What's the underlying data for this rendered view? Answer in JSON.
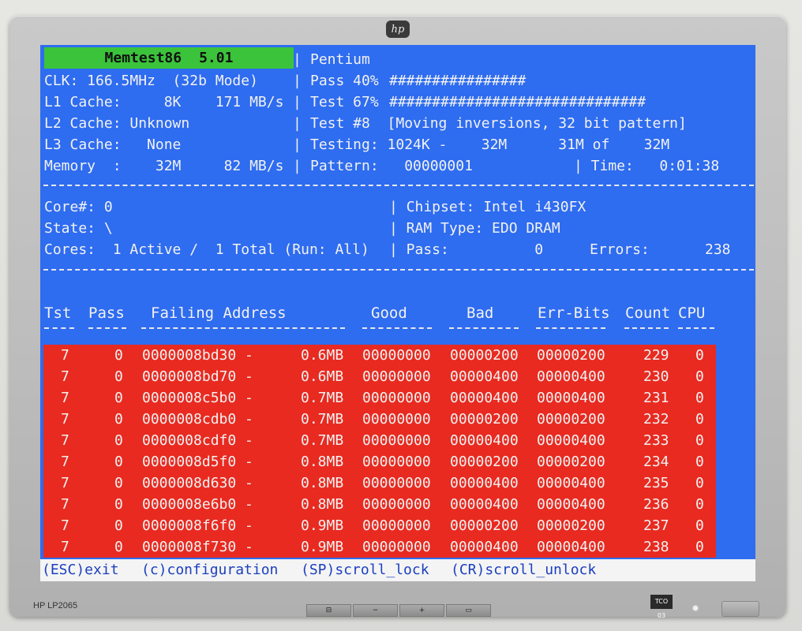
{
  "monitor": {
    "brand_logo": "hp",
    "model": "HP LP2065",
    "badge": "TCO 03"
  },
  "header": {
    "title": "Memtest86",
    "version": "5.01",
    "cpu": "Pentium",
    "clk": "CLK: 166.5MHz  (32b Mode)",
    "pass_label": "Pass 40%",
    "pass_bar": "################",
    "test_label": "Test 67%",
    "test_bar": "##############################",
    "l1": "L1 Cache:     8K    171 MB/s",
    "l2": "L2 Cache: Unknown",
    "l3": "L3 Cache:   None",
    "memory": "Memory  :    32M     82 MB/s",
    "test_num": "Test #8  [Moving inversions, 32 bit pattern]",
    "testing": "Testing: 1024K -    32M      31M of    32M",
    "pattern": "Pattern:   00000001",
    "time": "| Time:   0:01:38",
    "sep_char": "|"
  },
  "status": {
    "core": "Core#: 0",
    "state": "State: \\",
    "cores": "Cores:  1 Active /  1 Total (Run: All)",
    "chipset": "| Chipset: Intel i430FX",
    "ram_type": "| RAM Type: EDO DRAM",
    "pass": "| Pass:          0",
    "errors_label": "Errors:",
    "errors_value": "238"
  },
  "table": {
    "columns": [
      "Tst",
      "Pass",
      "Failing Address",
      "Good",
      "Bad",
      "Err-Bits",
      "Count",
      "CPU"
    ],
    "rows": [
      [
        "7",
        "0",
        "0000008bd30 -",
        "0.6MB",
        "00000000",
        "00000200",
        "00000200",
        "229",
        "0"
      ],
      [
        "7",
        "0",
        "0000008bd70 -",
        "0.6MB",
        "00000000",
        "00000400",
        "00000400",
        "230",
        "0"
      ],
      [
        "7",
        "0",
        "0000008c5b0 -",
        "0.7MB",
        "00000000",
        "00000400",
        "00000400",
        "231",
        "0"
      ],
      [
        "7",
        "0",
        "0000008cdb0 -",
        "0.7MB",
        "00000000",
        "00000200",
        "00000200",
        "232",
        "0"
      ],
      [
        "7",
        "0",
        "0000008cdf0 -",
        "0.7MB",
        "00000000",
        "00000400",
        "00000400",
        "233",
        "0"
      ],
      [
        "7",
        "0",
        "0000008d5f0 -",
        "0.8MB",
        "00000000",
        "00000200",
        "00000200",
        "234",
        "0"
      ],
      [
        "7",
        "0",
        "0000008d630 -",
        "0.8MB",
        "00000000",
        "00000400",
        "00000400",
        "235",
        "0"
      ],
      [
        "7",
        "0",
        "0000008e6b0 -",
        "0.8MB",
        "00000000",
        "00000400",
        "00000400",
        "236",
        "0"
      ],
      [
        "7",
        "0",
        "0000008f6f0 -",
        "0.9MB",
        "00000000",
        "00000200",
        "00000200",
        "237",
        "0"
      ],
      [
        "7",
        "0",
        "0000008f730 -",
        "0.9MB",
        "00000000",
        "00000400",
        "00000400",
        "238",
        "0"
      ]
    ]
  },
  "footer": {
    "esc": "(ESC)exit",
    "config": "(c)configuration",
    "scroll_lock": "(SP)scroll_lock",
    "scroll_unlock": "(CR)scroll_unlock"
  },
  "colors": {
    "screen": "#2e6cf0",
    "title": "#3bc43b",
    "error_rows": "#e82a20",
    "footer": "#f4f4f4",
    "footer_text": "#1b3fbf"
  }
}
